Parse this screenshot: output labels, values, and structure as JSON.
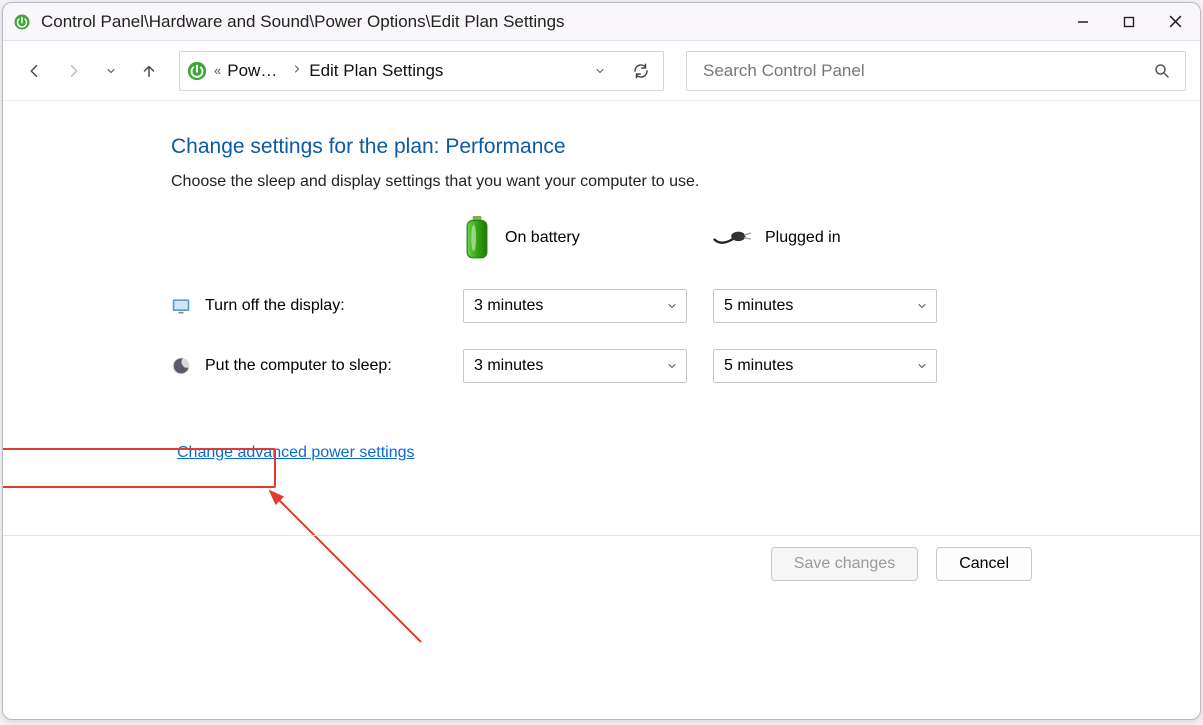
{
  "window": {
    "title": "Control Panel\\Hardware and Sound\\Power Options\\Edit Plan Settings"
  },
  "breadcrumb": {
    "segment1": "Power Options",
    "segment2": "Edit Plan Settings"
  },
  "search": {
    "placeholder": "Search Control Panel"
  },
  "page": {
    "heading_prefix": "Change settings for the plan: ",
    "plan_name": "Performance",
    "subtext": "Choose the sleep and display settings that you want your computer to use.",
    "battery_label": "On battery",
    "plugged_label": "Plugged in",
    "display_label": "Turn off the display:",
    "sleep_label": "Put the computer to sleep:",
    "display_battery": "3 minutes",
    "display_plugged": "5 minutes",
    "sleep_battery": "3 minutes",
    "sleep_plugged": "5 minutes",
    "advanced_link": "Change advanced power settings"
  },
  "footer": {
    "save": "Save changes",
    "cancel": "Cancel"
  }
}
